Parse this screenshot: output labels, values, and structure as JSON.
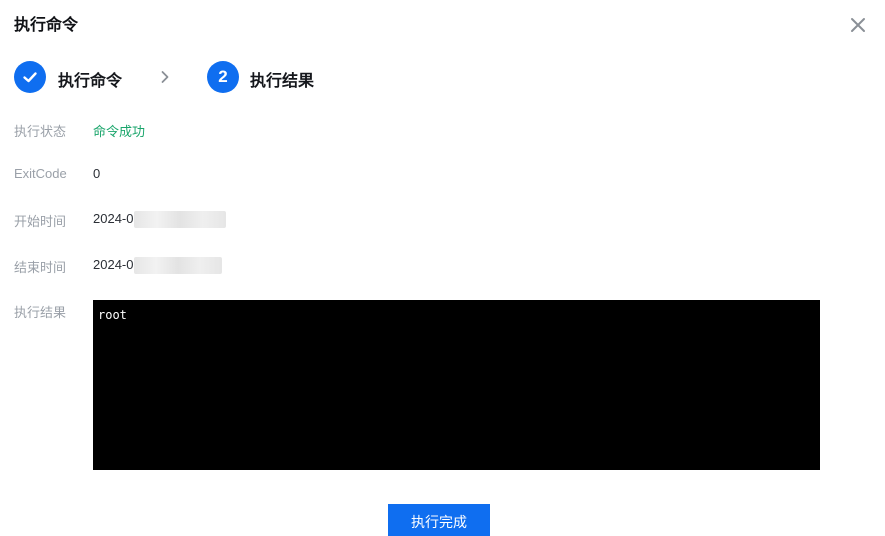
{
  "dialog": {
    "title": "执行命令",
    "close_icon": "close-icon"
  },
  "steps": [
    {
      "label": "执行命令",
      "status": "done",
      "icon": "check-icon"
    },
    {
      "label": "执行结果",
      "number": "2",
      "status": "active"
    }
  ],
  "details": {
    "status_label": "执行状态",
    "status_value": "命令成功",
    "exitcode_label": "ExitCode",
    "exitcode_value": "0",
    "start_label": "开始时间",
    "start_value": "2024-0",
    "end_label": "结束时间",
    "end_value": "2024-0",
    "result_label": "执行结果",
    "result_output": "root"
  },
  "footer": {
    "done_button": "执行完成"
  },
  "colors": {
    "primary": "#0f6ef0",
    "success": "#1aa56b",
    "terminal_bg": "#000000"
  }
}
